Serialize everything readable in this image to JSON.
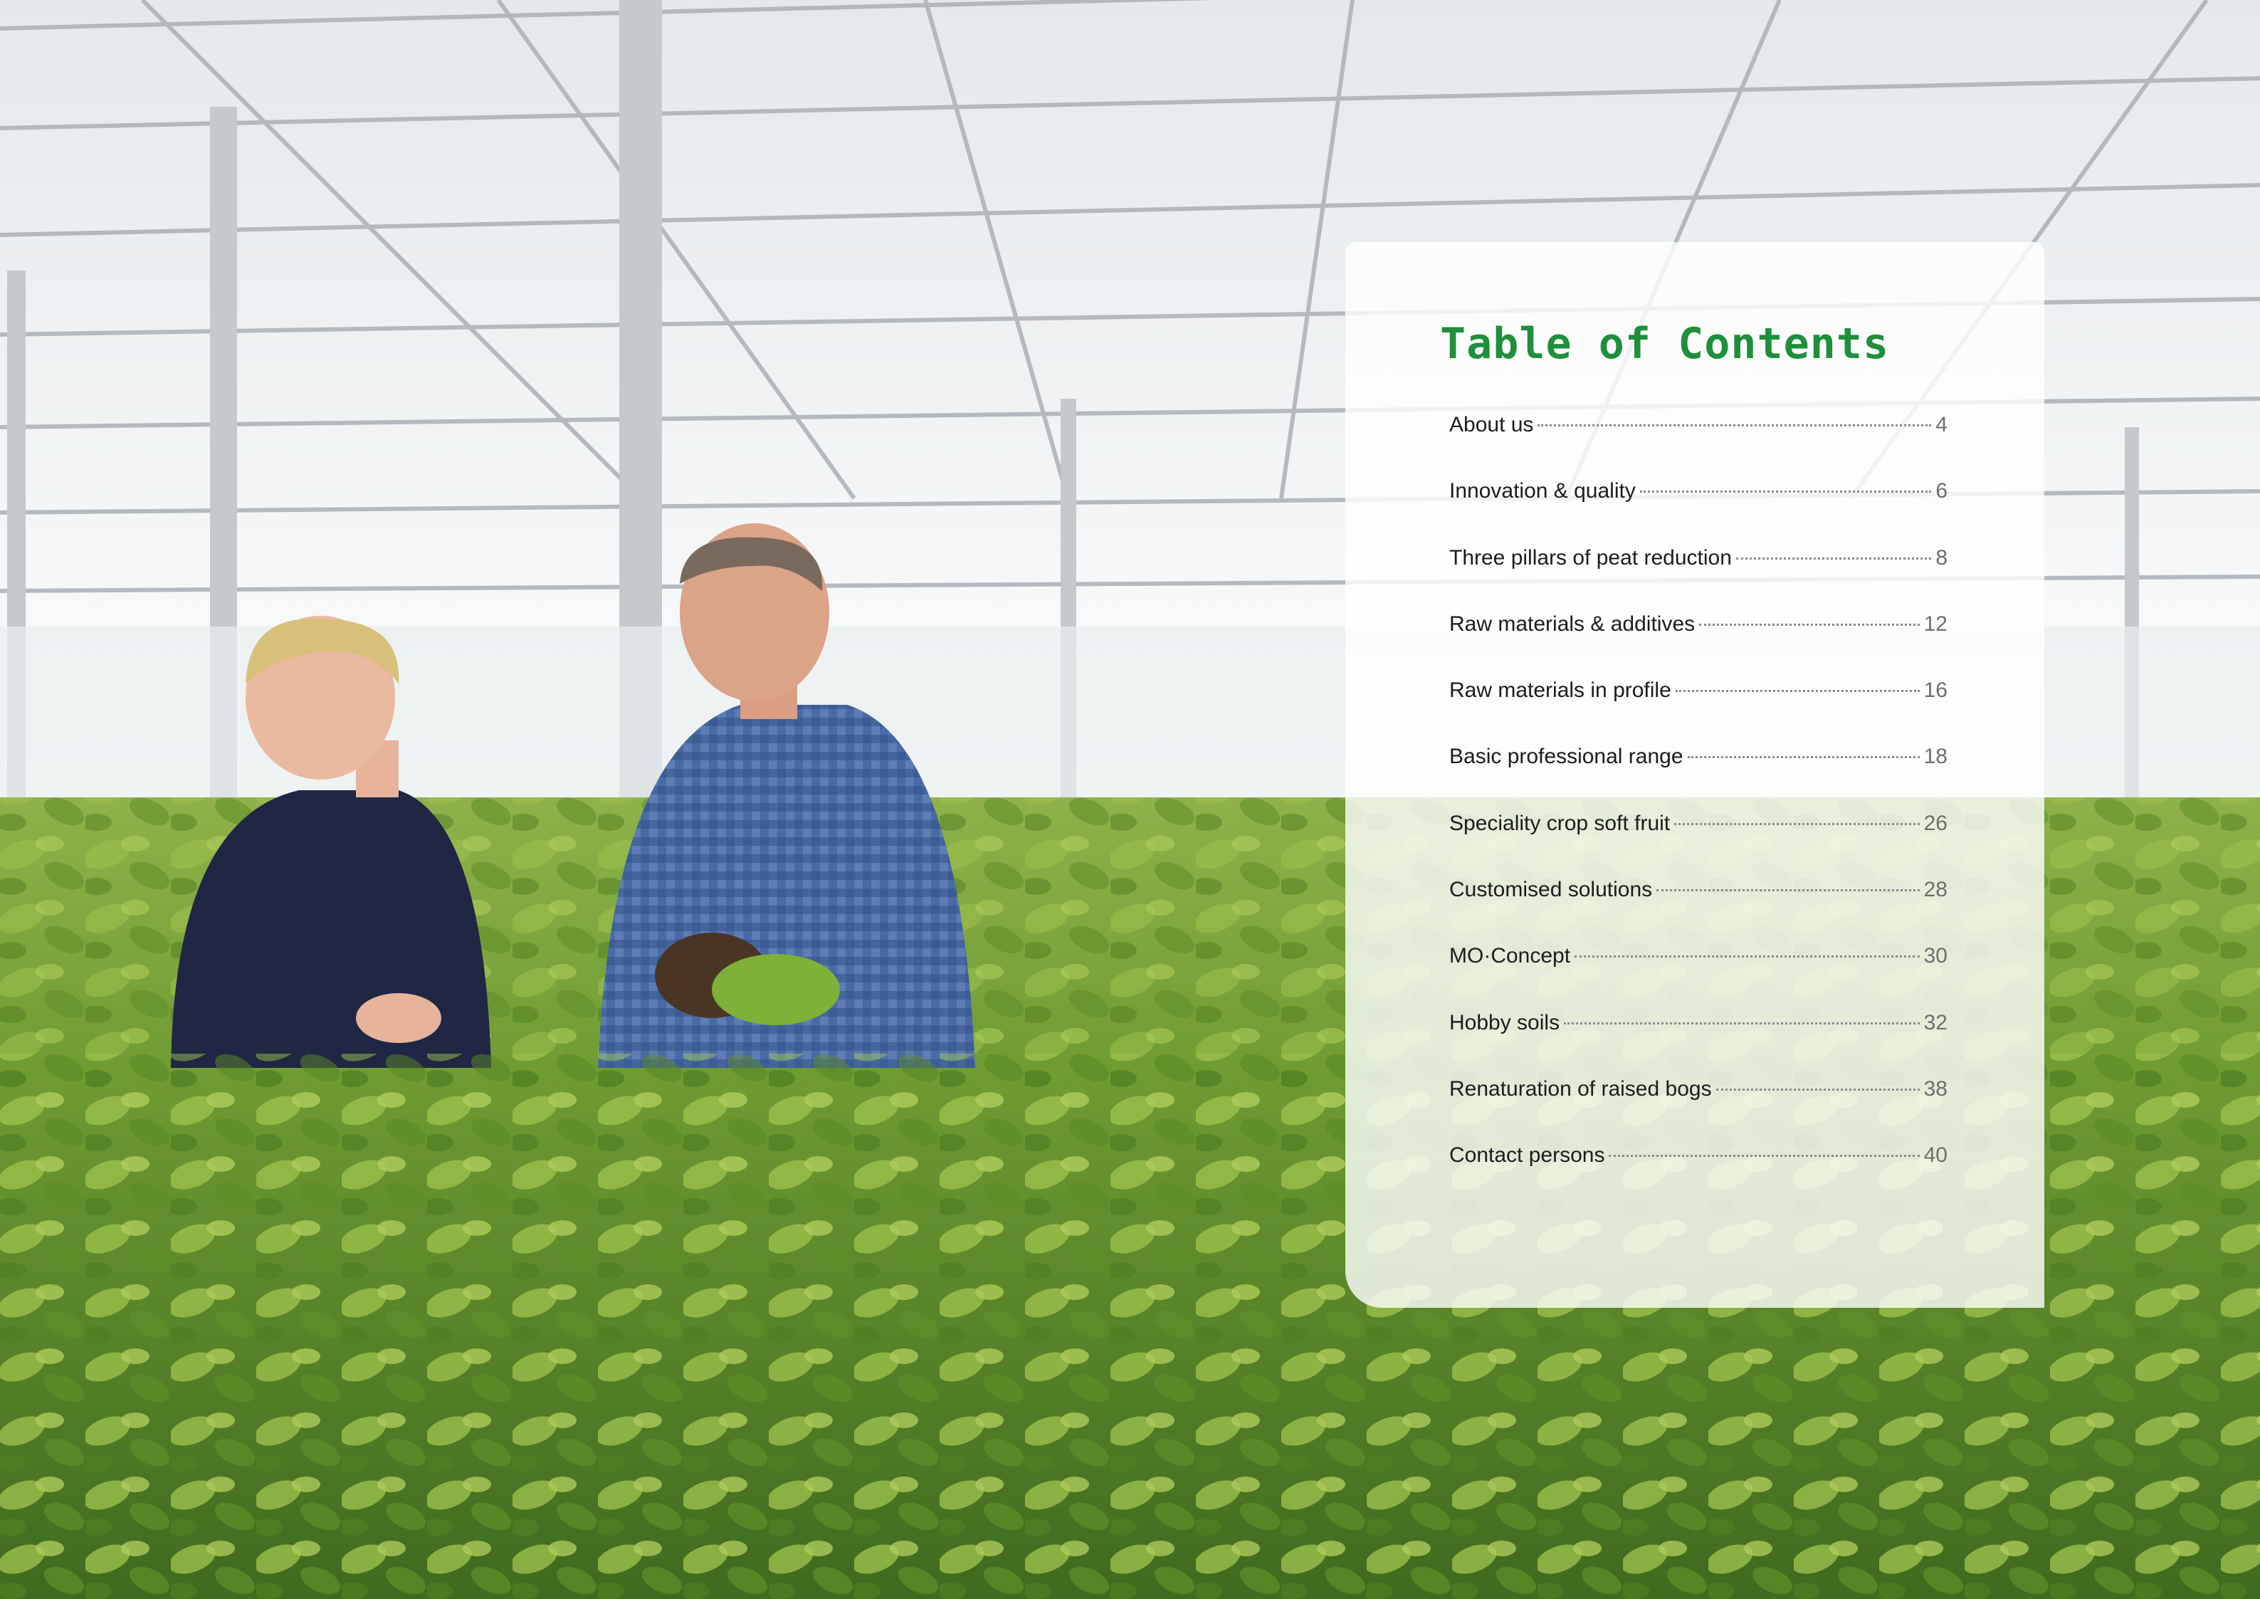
{
  "toc": {
    "title": "Table of Contents",
    "entries": [
      {
        "label": "About us",
        "page": "4"
      },
      {
        "label": "Innovation & quality",
        "page": "6"
      },
      {
        "label": "Three pillars of peat reduction",
        "page": "8"
      },
      {
        "label": "Raw materials & additives",
        "page": "12"
      },
      {
        "label": "Raw materials in profile",
        "page": "16"
      },
      {
        "label": "Basic professional range",
        "page": "18"
      },
      {
        "label": "Speciality crop soft fruit",
        "page": "26"
      },
      {
        "label": "Customised solutions",
        "page": "28"
      },
      {
        "label": "MO·Concept",
        "page": "30"
      },
      {
        "label": "Hobby soils",
        "page": "32"
      },
      {
        "label": "Renaturation of raised bogs",
        "page": "38"
      },
      {
        "label": "Contact persons",
        "page": "40"
      }
    ]
  },
  "colors": {
    "title_green": "#1e8f3b",
    "plant_green": "#6f9a3a",
    "glass_sky": "#eef1f3"
  }
}
